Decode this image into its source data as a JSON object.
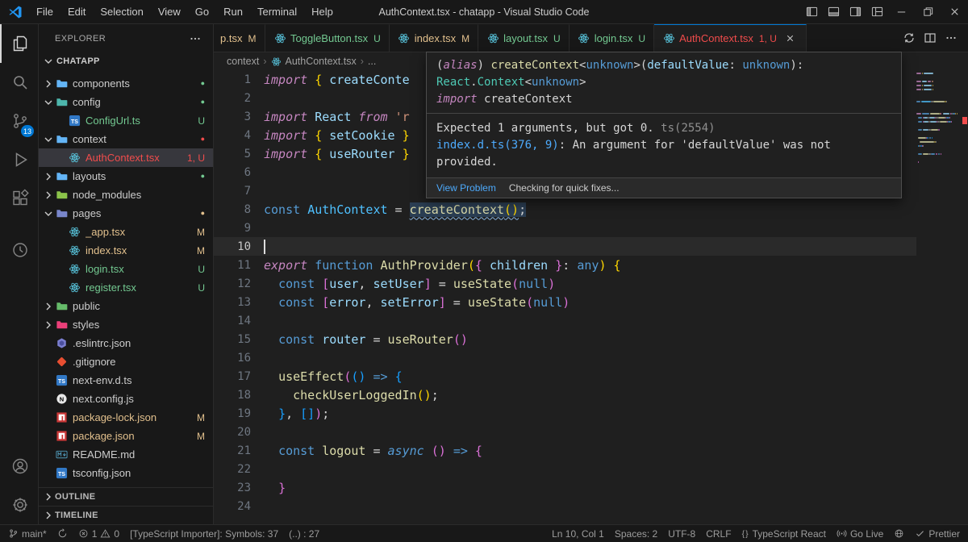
{
  "colors": {
    "accent": "#0078d4",
    "error": "#f14c4c",
    "modified": "#e2c08d",
    "untracked": "#73c991",
    "foreground": "#cccccc"
  },
  "title_bar": {
    "title": "AuthContext.tsx - chatapp - Visual Studio Code",
    "menus": [
      "File",
      "Edit",
      "Selection",
      "View",
      "Go",
      "Run",
      "Terminal",
      "Help"
    ],
    "controls": [
      {
        "name": "toggle-primary-sidebar",
        "icon": "layout-sidebar-icon"
      },
      {
        "name": "toggle-panel",
        "icon": "layout-panel-icon"
      },
      {
        "name": "toggle-secondary-sidebar",
        "icon": "layout-secondary-icon"
      },
      {
        "name": "customize-layout",
        "icon": "layout-customize-icon"
      },
      {
        "name": "minimize",
        "icon": "minimize-icon",
        "caption": true
      },
      {
        "name": "restore",
        "icon": "restore-icon",
        "caption": true
      },
      {
        "name": "close",
        "icon": "close-icon",
        "caption": true
      }
    ]
  },
  "activity_bar": {
    "top": [
      {
        "id": "explorer",
        "icon": "files-icon",
        "active": true
      },
      {
        "id": "search",
        "icon": "search-icon"
      },
      {
        "id": "source-control",
        "icon": "source-control-icon",
        "badge": "13"
      },
      {
        "id": "run-debug",
        "icon": "run-debug-icon"
      },
      {
        "id": "extensions",
        "icon": "extensions-icon"
      },
      {
        "id": "extra",
        "icon": "clock-icon",
        "gap": true
      }
    ],
    "bottom": [
      {
        "id": "accounts",
        "icon": "account-icon"
      },
      {
        "id": "settings",
        "icon": "gear-icon"
      }
    ]
  },
  "explorer": {
    "title": "EXPLORER",
    "workspace": "CHATAPP",
    "sections": [
      "OUTLINE",
      "TIMELINE"
    ],
    "items": [
      {
        "label": "components",
        "type": "folder",
        "depth": 0,
        "chevron": "right",
        "icon": "folder-icon",
        "icon_color": "#64b5f6",
        "dot": true,
        "dot_color": "untracked"
      },
      {
        "label": "config",
        "type": "folder",
        "depth": 0,
        "chevron": "down",
        "icon": "folder-icon",
        "icon_color": "#4db6ac",
        "dot": true,
        "dot_color": "untracked"
      },
      {
        "label": "ConfigUrl.ts",
        "type": "file",
        "depth": 1,
        "icon": "ts-icon",
        "badge": "U",
        "badge_color": "untracked",
        "label_color": "untracked"
      },
      {
        "label": "context",
        "type": "folder",
        "depth": 0,
        "chevron": "down",
        "icon": "folder-icon",
        "icon_color": "#64b5f6",
        "dot": true,
        "dot_color": "error"
      },
      {
        "label": "AuthContext.tsx",
        "type": "file",
        "depth": 1,
        "icon": "react-icon",
        "badge": "1, U",
        "badge_color": "error",
        "label_color": "error",
        "selected": true
      },
      {
        "label": "layouts",
        "type": "folder",
        "depth": 0,
        "chevron": "right",
        "icon": "folder-icon",
        "icon_color": "#64b5f6",
        "dot": true,
        "dot_color": "untracked"
      },
      {
        "label": "node_modules",
        "type": "folder",
        "depth": 0,
        "chevron": "right",
        "icon": "folder-icon",
        "icon_color": "#8bc34a"
      },
      {
        "label": "pages",
        "type": "folder",
        "depth": 0,
        "chevron": "down",
        "icon": "folder-icon",
        "icon_color": "#7986cb",
        "dot": true,
        "dot_color": "modified"
      },
      {
        "label": "_app.tsx",
        "type": "file",
        "depth": 1,
        "icon": "react-icon",
        "badge": "M",
        "badge_color": "modified",
        "label_color": "modified"
      },
      {
        "label": "index.tsx",
        "type": "file",
        "depth": 1,
        "icon": "react-icon",
        "badge": "M",
        "badge_color": "modified",
        "label_color": "modified"
      },
      {
        "label": "login.tsx",
        "type": "file",
        "depth": 1,
        "icon": "react-icon",
        "badge": "U",
        "badge_color": "untracked",
        "label_color": "untracked"
      },
      {
        "label": "register.tsx",
        "type": "file",
        "depth": 1,
        "icon": "react-icon",
        "badge": "U",
        "badge_color": "untracked",
        "label_color": "untracked"
      },
      {
        "label": "public",
        "type": "folder",
        "depth": 0,
        "chevron": "right",
        "icon": "folder-icon",
        "icon_color": "#66bb6a"
      },
      {
        "label": "styles",
        "type": "folder",
        "depth": 0,
        "chevron": "right",
        "icon": "folder-icon",
        "icon_color": "#ec407a"
      },
      {
        "label": ".eslintrc.json",
        "type": "file",
        "depth": 0,
        "icon": "eslint-icon"
      },
      {
        "label": ".gitignore",
        "type": "file",
        "depth": 0,
        "icon": "git-icon"
      },
      {
        "label": "next-env.d.ts",
        "type": "file",
        "depth": 0,
        "icon": "ts-icon"
      },
      {
        "label": "next.config.js",
        "type": "file",
        "depth": 0,
        "icon": "next-icon"
      },
      {
        "label": "package-lock.json",
        "type": "file",
        "depth": 0,
        "icon": "npm-icon",
        "badge": "M",
        "badge_color": "modified",
        "label_color": "modified"
      },
      {
        "label": "package.json",
        "type": "file",
        "depth": 0,
        "icon": "npm-icon",
        "badge": "M",
        "badge_color": "modified",
        "label_color": "modified"
      },
      {
        "label": "README.md",
        "type": "file",
        "depth": 0,
        "icon": "markdown-icon"
      },
      {
        "label": "tsconfig.json",
        "type": "file",
        "depth": 0,
        "icon": "ts-icon"
      }
    ]
  },
  "tab_bar": {
    "tabs": [
      {
        "label": "p.tsx",
        "badge": "M",
        "badge_color": "modified",
        "color": "modified",
        "clipped": true
      },
      {
        "label": "ToggleButton.tsx",
        "icon": "react-icon",
        "badge": "U",
        "badge_color": "untracked",
        "color": "untracked"
      },
      {
        "label": "index.tsx",
        "icon": "react-icon",
        "badge": "M",
        "badge_color": "modified",
        "color": "modified"
      },
      {
        "label": "layout.tsx",
        "icon": "react-icon",
        "badge": "U",
        "badge_color": "untracked",
        "color": "untracked"
      },
      {
        "label": "login.tsx",
        "icon": "react-icon",
        "badge": "U",
        "badge_color": "untracked",
        "color": "untracked"
      },
      {
        "label": "AuthContext.tsx",
        "icon": "react-icon",
        "badge": "1, U",
        "badge_color": "error",
        "color": "error",
        "active": true
      }
    ],
    "actions": [
      {
        "name": "open-changes-button",
        "icon": "compare-icon"
      },
      {
        "name": "split-editor-button",
        "icon": "split-editor-icon"
      },
      {
        "name": "editor-more-actions-button",
        "icon": "more-icon"
      }
    ]
  },
  "breadcrumb": {
    "items": [
      {
        "label": "context"
      },
      {
        "label": "AuthContext.tsx",
        "icon": "react-icon"
      },
      {
        "label": "..."
      }
    ]
  },
  "editor": {
    "active_line": 10,
    "lines": [
      {
        "n": 1,
        "t": [
          [
            "i",
            "import"
          ],
          [
            "p",
            " "
          ],
          [
            "b1",
            "{"
          ],
          [
            "p",
            " "
          ],
          [
            "v",
            "createConte"
          ]
        ]
      },
      {
        "n": 2,
        "t": []
      },
      {
        "n": 3,
        "t": [
          [
            "i",
            "import"
          ],
          [
            "p",
            " "
          ],
          [
            "v",
            "React"
          ],
          [
            "p",
            " "
          ],
          [
            "i",
            "from"
          ],
          [
            "p",
            " "
          ],
          [
            "s",
            "'r"
          ]
        ]
      },
      {
        "n": 4,
        "t": [
          [
            "i",
            "import"
          ],
          [
            "p",
            " "
          ],
          [
            "b1",
            "{"
          ],
          [
            "p",
            " "
          ],
          [
            "v",
            "setCookie"
          ],
          [
            "p",
            " "
          ],
          [
            "b1",
            "}"
          ]
        ]
      },
      {
        "n": 5,
        "t": [
          [
            "i",
            "import"
          ],
          [
            "p",
            " "
          ],
          [
            "b1",
            "{"
          ],
          [
            "p",
            " "
          ],
          [
            "v",
            "useRouter"
          ],
          [
            "p",
            " "
          ],
          [
            "b1",
            "}"
          ]
        ]
      },
      {
        "n": 6,
        "t": []
      },
      {
        "n": 7,
        "t": []
      },
      {
        "n": 8,
        "t": [
          [
            "k",
            "const"
          ],
          [
            "p",
            " "
          ],
          [
            "c",
            "AuthContext"
          ],
          [
            "p",
            " = "
          ],
          [
            "f sq hl",
            "createContext"
          ],
          [
            "b1 sq hl",
            "()"
          ],
          [
            "p hl",
            ";"
          ]
        ]
      },
      {
        "n": 9,
        "t": []
      },
      {
        "n": 10,
        "t": []
      },
      {
        "n": 11,
        "t": [
          [
            "i",
            "export"
          ],
          [
            "p",
            " "
          ],
          [
            "k",
            "function"
          ],
          [
            "p",
            " "
          ],
          [
            "f",
            "AuthProvider"
          ],
          [
            "b1",
            "("
          ],
          [
            "b2",
            "{"
          ],
          [
            "p",
            " "
          ],
          [
            "v",
            "children"
          ],
          [
            "p",
            " "
          ],
          [
            "b2",
            "}"
          ],
          [
            "p",
            ": "
          ],
          [
            "k",
            "any"
          ],
          [
            "b1",
            ")"
          ],
          [
            "p",
            " "
          ],
          [
            "b1",
            "{"
          ]
        ]
      },
      {
        "n": 12,
        "t": [
          [
            "p",
            "  "
          ],
          [
            "k",
            "const"
          ],
          [
            "p",
            " "
          ],
          [
            "b2",
            "["
          ],
          [
            "v",
            "user"
          ],
          [
            "p",
            ", "
          ],
          [
            "v",
            "setUser"
          ],
          [
            "b2",
            "]"
          ],
          [
            "p",
            " = "
          ],
          [
            "f",
            "useState"
          ],
          [
            "b2",
            "("
          ],
          [
            "k",
            "null"
          ],
          [
            "b2",
            ")"
          ]
        ]
      },
      {
        "n": 13,
        "t": [
          [
            "p",
            "  "
          ],
          [
            "k",
            "const"
          ],
          [
            "p",
            " "
          ],
          [
            "b2",
            "["
          ],
          [
            "v",
            "error"
          ],
          [
            "p",
            ", "
          ],
          [
            "v",
            "setError"
          ],
          [
            "b2",
            "]"
          ],
          [
            "p",
            " = "
          ],
          [
            "f",
            "useState"
          ],
          [
            "b2",
            "("
          ],
          [
            "k",
            "null"
          ],
          [
            "b2",
            ")"
          ]
        ]
      },
      {
        "n": 14,
        "t": []
      },
      {
        "n": 15,
        "t": [
          [
            "p",
            "  "
          ],
          [
            "k",
            "const"
          ],
          [
            "p",
            " "
          ],
          [
            "v",
            "router"
          ],
          [
            "p",
            " = "
          ],
          [
            "f",
            "useRouter"
          ],
          [
            "b2",
            "()"
          ]
        ]
      },
      {
        "n": 16,
        "t": []
      },
      {
        "n": 17,
        "t": [
          [
            "p",
            "  "
          ],
          [
            "f",
            "useEffect"
          ],
          [
            "b2",
            "("
          ],
          [
            "b3",
            "()"
          ],
          [
            "p",
            " "
          ],
          [
            "k",
            "=>"
          ],
          [
            "p",
            " "
          ],
          [
            "b3",
            "{"
          ]
        ]
      },
      {
        "n": 18,
        "t": [
          [
            "p",
            "    "
          ],
          [
            "f",
            "checkUserLoggedIn"
          ],
          [
            "b1",
            "()"
          ],
          [
            "p",
            ";"
          ]
        ]
      },
      {
        "n": 19,
        "t": [
          [
            "p",
            "  "
          ],
          [
            "b3",
            "}"
          ],
          [
            "p",
            ", "
          ],
          [
            "b3",
            "[]"
          ],
          [
            "b2",
            ")"
          ],
          [
            "p",
            ";"
          ]
        ]
      },
      {
        "n": 20,
        "t": []
      },
      {
        "n": 21,
        "t": [
          [
            "p",
            "  "
          ],
          [
            "k",
            "const"
          ],
          [
            "p",
            " "
          ],
          [
            "f",
            "logout"
          ],
          [
            "p",
            " = "
          ],
          [
            "ki",
            "async"
          ],
          [
            "p",
            " "
          ],
          [
            "b2",
            "()"
          ],
          [
            "p",
            " "
          ],
          [
            "k",
            "=>"
          ],
          [
            "p",
            " "
          ],
          [
            "b2",
            "{"
          ]
        ]
      },
      {
        "n": 22,
        "t": []
      },
      {
        "n": 23,
        "t": [
          [
            "p",
            "  "
          ],
          [
            "b2",
            "}"
          ]
        ]
      },
      {
        "n": 24,
        "t": []
      }
    ]
  },
  "hover": {
    "signature": [
      [
        [
          "w",
          "("
        ],
        [
          "i",
          "alias"
        ],
        [
          "w",
          ") "
        ],
        [
          "f",
          "createContext"
        ],
        [
          "p",
          "<"
        ],
        [
          "k",
          "unknown"
        ],
        [
          "p",
          ">("
        ],
        [
          "v",
          "defaultValue"
        ],
        [
          "p",
          ": "
        ],
        [
          "k",
          "unknown"
        ],
        [
          "p",
          "):"
        ]
      ],
      [
        [
          "t",
          "React"
        ],
        [
          "p",
          "."
        ],
        [
          "t",
          "Context"
        ],
        [
          "p",
          "<"
        ],
        [
          "k",
          "unknown"
        ],
        [
          "p",
          ">"
        ]
      ],
      [
        [
          "i",
          "import"
        ],
        [
          "p",
          " "
        ],
        [
          "w",
          "createContext"
        ]
      ]
    ],
    "diagnostics": [
      [
        [
          "w",
          "Expected 1 arguments, but got 0. "
        ],
        [
          "dim",
          "ts(2554)"
        ]
      ],
      [
        [
          "link",
          "index.d.ts(376, 9)"
        ],
        [
          "w",
          ": An argument for 'defaultValue' was not provided."
        ]
      ]
    ],
    "view_problem": "View Problem",
    "quick_fix_status": "Checking for quick fixes..."
  },
  "status_bar": {
    "left": [
      {
        "name": "git-branch-status",
        "parts": [
          {
            "icon": "branch-icon"
          },
          {
            "text": "main*"
          }
        ]
      },
      {
        "name": "sync-status",
        "parts": [
          {
            "icon": "sync-icon"
          }
        ]
      },
      {
        "name": "problems-status",
        "parts": [
          {
            "icon": "error-icon"
          },
          {
            "text": "1"
          },
          {
            "icon": "warning-icon"
          },
          {
            "text": "0"
          }
        ]
      },
      {
        "name": "ts-importer-status",
        "parts": [
          {
            "text": "[TypeScript Importer]: Symbols: 37"
          }
        ]
      },
      {
        "name": "symbol-count-status",
        "parts": [
          {
            "text": "(..) : 27"
          }
        ]
      }
    ],
    "right": [
      {
        "name": "cursor-position-status",
        "parts": [
          {
            "text": "Ln 10, Col 1"
          }
        ]
      },
      {
        "name": "indentation-status",
        "parts": [
          {
            "text": "Spaces: 2"
          }
        ]
      },
      {
        "name": "encoding-status",
        "parts": [
          {
            "text": "UTF-8"
          }
        ]
      },
      {
        "name": "eol-status",
        "parts": [
          {
            "text": "CRLF"
          }
        ]
      },
      {
        "name": "language-mode-status",
        "parts": [
          {
            "icon": "braces-icon"
          },
          {
            "text": "TypeScript React"
          }
        ]
      },
      {
        "name": "go-live-status",
        "parts": [
          {
            "icon": "broadcast-icon"
          },
          {
            "text": "Go Live"
          }
        ]
      },
      {
        "name": "extension-status",
        "parts": [
          {
            "icon": "globe-icon"
          }
        ]
      },
      {
        "name": "prettier-status",
        "parts": [
          {
            "icon": "check-icon"
          },
          {
            "text": "Prettier"
          }
        ]
      }
    ]
  }
}
